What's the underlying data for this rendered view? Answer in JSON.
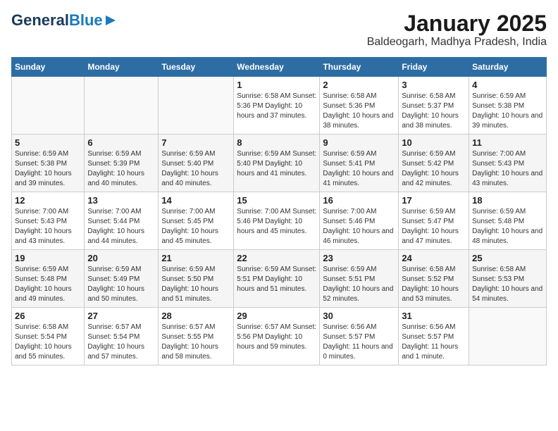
{
  "header": {
    "logo_general": "General",
    "logo_blue": "Blue",
    "title": "January 2025",
    "subtitle": "Baldeogarh, Madhya Pradesh, India"
  },
  "days_of_week": [
    "Sunday",
    "Monday",
    "Tuesday",
    "Wednesday",
    "Thursday",
    "Friday",
    "Saturday"
  ],
  "weeks": [
    [
      {
        "day": "",
        "content": ""
      },
      {
        "day": "",
        "content": ""
      },
      {
        "day": "",
        "content": ""
      },
      {
        "day": "1",
        "content": "Sunrise: 6:58 AM\nSunset: 5:36 PM\nDaylight: 10 hours\nand 37 minutes."
      },
      {
        "day": "2",
        "content": "Sunrise: 6:58 AM\nSunset: 5:36 PM\nDaylight: 10 hours\nand 38 minutes."
      },
      {
        "day": "3",
        "content": "Sunrise: 6:58 AM\nSunset: 5:37 PM\nDaylight: 10 hours\nand 38 minutes."
      },
      {
        "day": "4",
        "content": "Sunrise: 6:59 AM\nSunset: 5:38 PM\nDaylight: 10 hours\nand 39 minutes."
      }
    ],
    [
      {
        "day": "5",
        "content": "Sunrise: 6:59 AM\nSunset: 5:38 PM\nDaylight: 10 hours\nand 39 minutes."
      },
      {
        "day": "6",
        "content": "Sunrise: 6:59 AM\nSunset: 5:39 PM\nDaylight: 10 hours\nand 40 minutes."
      },
      {
        "day": "7",
        "content": "Sunrise: 6:59 AM\nSunset: 5:40 PM\nDaylight: 10 hours\nand 40 minutes."
      },
      {
        "day": "8",
        "content": "Sunrise: 6:59 AM\nSunset: 5:40 PM\nDaylight: 10 hours\nand 41 minutes."
      },
      {
        "day": "9",
        "content": "Sunrise: 6:59 AM\nSunset: 5:41 PM\nDaylight: 10 hours\nand 41 minutes."
      },
      {
        "day": "10",
        "content": "Sunrise: 6:59 AM\nSunset: 5:42 PM\nDaylight: 10 hours\nand 42 minutes."
      },
      {
        "day": "11",
        "content": "Sunrise: 7:00 AM\nSunset: 5:43 PM\nDaylight: 10 hours\nand 43 minutes."
      }
    ],
    [
      {
        "day": "12",
        "content": "Sunrise: 7:00 AM\nSunset: 5:43 PM\nDaylight: 10 hours\nand 43 minutes."
      },
      {
        "day": "13",
        "content": "Sunrise: 7:00 AM\nSunset: 5:44 PM\nDaylight: 10 hours\nand 44 minutes."
      },
      {
        "day": "14",
        "content": "Sunrise: 7:00 AM\nSunset: 5:45 PM\nDaylight: 10 hours\nand 45 minutes."
      },
      {
        "day": "15",
        "content": "Sunrise: 7:00 AM\nSunset: 5:46 PM\nDaylight: 10 hours\nand 45 minutes."
      },
      {
        "day": "16",
        "content": "Sunrise: 7:00 AM\nSunset: 5:46 PM\nDaylight: 10 hours\nand 46 minutes."
      },
      {
        "day": "17",
        "content": "Sunrise: 6:59 AM\nSunset: 5:47 PM\nDaylight: 10 hours\nand 47 minutes."
      },
      {
        "day": "18",
        "content": "Sunrise: 6:59 AM\nSunset: 5:48 PM\nDaylight: 10 hours\nand 48 minutes."
      }
    ],
    [
      {
        "day": "19",
        "content": "Sunrise: 6:59 AM\nSunset: 5:48 PM\nDaylight: 10 hours\nand 49 minutes."
      },
      {
        "day": "20",
        "content": "Sunrise: 6:59 AM\nSunset: 5:49 PM\nDaylight: 10 hours\nand 50 minutes."
      },
      {
        "day": "21",
        "content": "Sunrise: 6:59 AM\nSunset: 5:50 PM\nDaylight: 10 hours\nand 51 minutes."
      },
      {
        "day": "22",
        "content": "Sunrise: 6:59 AM\nSunset: 5:51 PM\nDaylight: 10 hours\nand 51 minutes."
      },
      {
        "day": "23",
        "content": "Sunrise: 6:59 AM\nSunset: 5:51 PM\nDaylight: 10 hours\nand 52 minutes."
      },
      {
        "day": "24",
        "content": "Sunrise: 6:58 AM\nSunset: 5:52 PM\nDaylight: 10 hours\nand 53 minutes."
      },
      {
        "day": "25",
        "content": "Sunrise: 6:58 AM\nSunset: 5:53 PM\nDaylight: 10 hours\nand 54 minutes."
      }
    ],
    [
      {
        "day": "26",
        "content": "Sunrise: 6:58 AM\nSunset: 5:54 PM\nDaylight: 10 hours\nand 55 minutes."
      },
      {
        "day": "27",
        "content": "Sunrise: 6:57 AM\nSunset: 5:54 PM\nDaylight: 10 hours\nand 57 minutes."
      },
      {
        "day": "28",
        "content": "Sunrise: 6:57 AM\nSunset: 5:55 PM\nDaylight: 10 hours\nand 58 minutes."
      },
      {
        "day": "29",
        "content": "Sunrise: 6:57 AM\nSunset: 5:56 PM\nDaylight: 10 hours\nand 59 minutes."
      },
      {
        "day": "30",
        "content": "Sunrise: 6:56 AM\nSunset: 5:57 PM\nDaylight: 11 hours\nand 0 minutes."
      },
      {
        "day": "31",
        "content": "Sunrise: 6:56 AM\nSunset: 5:57 PM\nDaylight: 11 hours\nand 1 minute."
      },
      {
        "day": "",
        "content": ""
      }
    ]
  ]
}
